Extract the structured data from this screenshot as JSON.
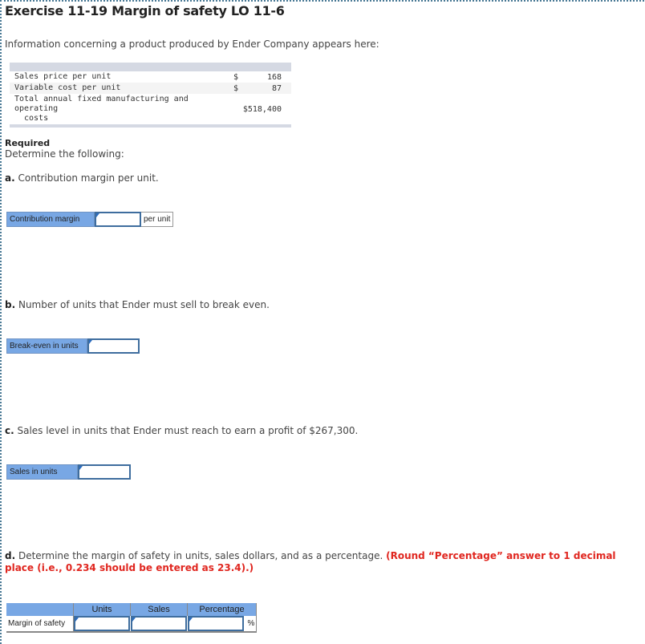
{
  "title": "Exercise 11-19 Margin of safety LO 11-6",
  "intro": "Information concerning a product produced by Ender Company appears here:",
  "info_table": {
    "rows": [
      {
        "label": "Sales price per unit",
        "currency": "$",
        "value": "168"
      },
      {
        "label": "Variable cost per unit",
        "currency": "$",
        "value": "87"
      },
      {
        "label": "Total annual fixed manufacturing and operating",
        "label_cont": "costs",
        "value_full": "$518,400"
      }
    ]
  },
  "required": {
    "heading": "Required",
    "text": "Determine the following:"
  },
  "questions": {
    "a": {
      "letter": "a.",
      "text": " Contribution margin per unit.",
      "label": "Contribution margin",
      "unit": "per unit",
      "value": ""
    },
    "b": {
      "letter": "b.",
      "text": " Number of units that Ender must sell to break even.",
      "label": "Break-even in units",
      "value": ""
    },
    "c": {
      "letter": "c.",
      "text": " Sales level in units that Ender must reach to earn a profit of $267,300.",
      "label": "Sales in units",
      "value": ""
    },
    "d": {
      "letter": "d.",
      "text": " Determine the margin of safety in units, sales dollars, and as a percentage. ",
      "instruction": "(Round “Percentage” answer to 1 decimal place (i.e., 0.234 should be entered as 23.4).)",
      "columns": [
        "Units",
        "Sales",
        "Percentage"
      ],
      "row_label": "Margin of safety",
      "percent_sign": "%",
      "values": {
        "units": "",
        "sales": "",
        "percentage": ""
      }
    }
  }
}
